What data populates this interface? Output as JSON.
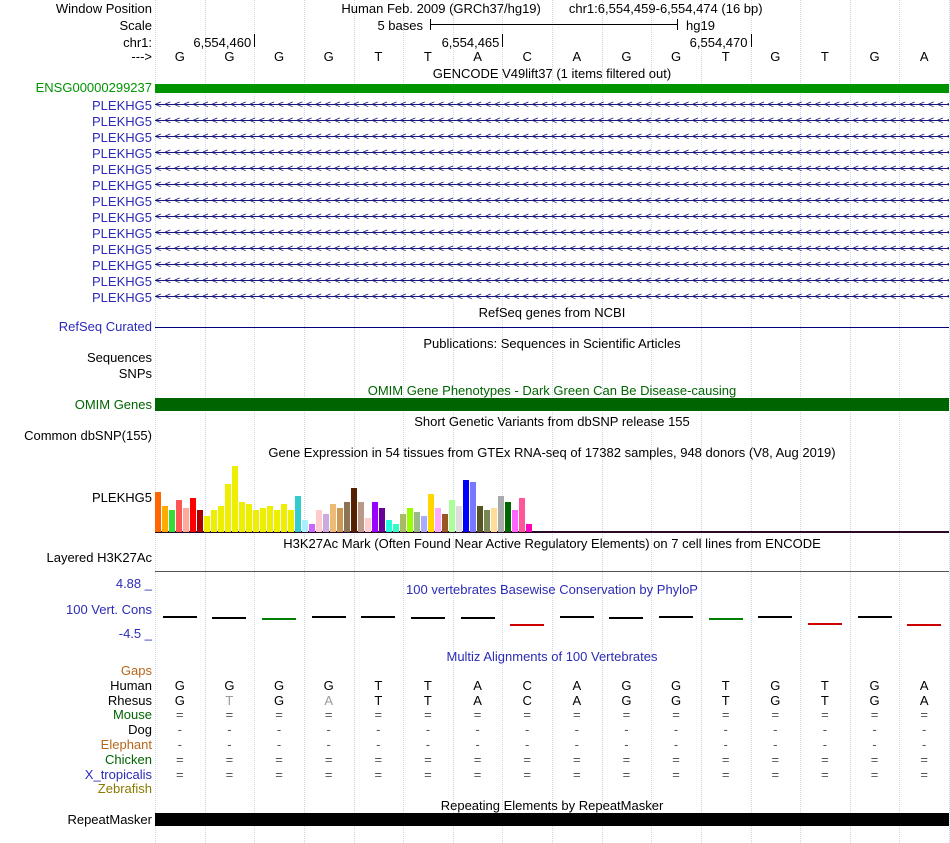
{
  "header": {
    "window_position_label": "Window Position",
    "assembly": "Human Feb. 2009 (GRCh37/hg19)",
    "position": "chr1:6,554,459-6,554,474 (16 bp)",
    "scale_label": "Scale",
    "scale_bar_label": "5 bases",
    "assembly_tag": "hg19",
    "chrom_label": "chr1:",
    "strand_arrow": "--->"
  },
  "ruler": {
    "ticks": [
      {
        "label": "6,554,460",
        "offset": 2
      },
      {
        "label": "6,554,465",
        "offset": 7
      },
      {
        "label": "6,554,470",
        "offset": 12
      }
    ]
  },
  "sequence": {
    "bases": [
      "G",
      "G",
      "G",
      "G",
      "T",
      "T",
      "A",
      "C",
      "A",
      "G",
      "G",
      "T",
      "G",
      "T",
      "G",
      "A"
    ]
  },
  "gencode": {
    "title": "GENCODE V49lift37 (1 items filtered out)",
    "gene": {
      "label": "ENSG00000299237",
      "color": "#009400"
    },
    "transcript_labels": [
      "PLEKHG5",
      "PLEKHG5",
      "PLEKHG5",
      "PLEKHG5",
      "PLEKHG5",
      "PLEKHG5",
      "PLEKHG5",
      "PLEKHG5",
      "PLEKHG5",
      "PLEKHG5",
      "PLEKHG5",
      "PLEKHG5",
      "PLEKHG5"
    ],
    "arrow_char": "<",
    "line_color": "#16167d"
  },
  "refseq": {
    "title": "RefSeq genes from NCBI",
    "label": "RefSeq Curated"
  },
  "publications": {
    "title": "Publications: Sequences in Scientific Articles",
    "sequences_label": "Sequences",
    "snps_label": "SNPs"
  },
  "omim": {
    "title": "OMIM Gene Phenotypes - Dark Green Can Be Disease-causing",
    "label": "OMIM Genes",
    "color": "#006400"
  },
  "dbsnp": {
    "title": "Short Genetic Variants from dbSNP release 155",
    "label": "Common dbSNP(155)"
  },
  "gtex": {
    "title": "Gene Expression in 54 tissues from GTEx RNA-seq of 17382 samples, 948 donors (V8, Aug 2019)",
    "label": "PLEKHG5",
    "chart_data": {
      "type": "bar",
      "n_bars": 54,
      "note": "relative expression bar heights in px (max 70)",
      "values": [
        40,
        26,
        22,
        32,
        24,
        34,
        22,
        16,
        22,
        26,
        48,
        66,
        30,
        28,
        22,
        24,
        26,
        22,
        28,
        22,
        36,
        12,
        8,
        22,
        18,
        28,
        24,
        30,
        44,
        30,
        14,
        30,
        24,
        12,
        8,
        18,
        24,
        20,
        16,
        38,
        24,
        18,
        32,
        26,
        52,
        50,
        26,
        22,
        24,
        36,
        30,
        22,
        34,
        8
      ],
      "colors": [
        "#FF6600",
        "#FFAA00",
        "#33DD33",
        "#FF5555",
        "#FFAA99",
        "#FF0000",
        "#AA0000",
        "#EEEE00",
        "#EEEE00",
        "#EEEE00",
        "#EEEE00",
        "#EEEE00",
        "#EEEE00",
        "#EEEE00",
        "#EEEE00",
        "#EEEE00",
        "#EEEE00",
        "#EEEE00",
        "#EEEE00",
        "#EEEE00",
        "#33CCCC",
        "#AAEEFF",
        "#CC66FF",
        "#FFCCCC",
        "#CCAADD",
        "#EEBB77",
        "#CC9955",
        "#8B7355",
        "#552200",
        "#BB9988",
        "#FFCCCC",
        "#9900FF",
        "#660099",
        "#22FFDD",
        "#33FFC2",
        "#AABB66",
        "#99FF00",
        "#99BB88",
        "#AAAAFF",
        "#FFD700",
        "#FFAAFF",
        "#995522",
        "#AAFF99",
        "#DDDDDD",
        "#0000FF",
        "#7777FF",
        "#555522",
        "#778855",
        "#FFDD99",
        "#AAAAAA",
        "#006600",
        "#FF66FF",
        "#FF5599",
        "#FF00BB"
      ]
    }
  },
  "h3k27ac": {
    "title": "H3K27Ac Mark (Often Found Near Active Regulatory Elements) on 7 cell lines from ENCODE",
    "label": "Layered H3K27Ac"
  },
  "phylop": {
    "title": "100 vertebrates Basewise Conservation by PhyloP",
    "label": "100 Vert. Cons",
    "max_label": "4.88 _",
    "min_label": "-4.5 _",
    "chart_data": {
      "type": "wiggle",
      "ylim": [
        -4.5,
        4.88
      ],
      "values": [
        0.5,
        0.4,
        0.2,
        0.45,
        0.55,
        0.35,
        0.4,
        -0.45,
        0.5,
        0.4,
        0.45,
        0.2,
        0.5,
        -0.35,
        0.45,
        -0.5
      ],
      "colors": [
        "#000000",
        "#000000",
        "#008000",
        "#000000",
        "#000000",
        "#000000",
        "#000000",
        "#cc0000",
        "#000000",
        "#000000",
        "#000000",
        "#008000",
        "#000000",
        "#cc0000",
        "#000000",
        "#cc0000"
      ]
    }
  },
  "multiz": {
    "title": "Multiz Alignments of 100 Vertebrates",
    "rows": [
      {
        "species": "Gaps",
        "color": "#b8651b",
        "cells": [
          "",
          "",
          "",
          "",
          "",
          "",
          "",
          "",
          "",
          "",
          "",
          "",
          "",
          "",
          "",
          ""
        ]
      },
      {
        "species": "Human",
        "color": "#000000",
        "cells": [
          "G",
          "G",
          "G",
          "G",
          "T",
          "T",
          "A",
          "C",
          "A",
          "G",
          "G",
          "T",
          "G",
          "T",
          "G",
          "A"
        ]
      },
      {
        "species": "Rhesus",
        "color": "#000000",
        "cells": [
          "G",
          "T",
          "G",
          "A",
          "T",
          "T",
          "A",
          "C",
          "A",
          "G",
          "G",
          "T",
          "G",
          "T",
          "G",
          "A"
        ],
        "dim_indices": [
          1,
          3
        ]
      },
      {
        "species": "Mouse",
        "color": "#006400",
        "cells": [
          "=",
          "=",
          "=",
          "=",
          "=",
          "=",
          "=",
          "=",
          "=",
          "=",
          "=",
          "=",
          "=",
          "=",
          "=",
          "="
        ]
      },
      {
        "species": "Dog",
        "color": "#000000",
        "cells": [
          "-",
          "-",
          "-",
          "-",
          "-",
          "-",
          "-",
          "-",
          "-",
          "-",
          "-",
          "-",
          "-",
          "-",
          "-",
          "-"
        ]
      },
      {
        "species": "Elephant",
        "color": "#b8651b",
        "cells": [
          "-",
          "-",
          "-",
          "-",
          "-",
          "-",
          "-",
          "-",
          "-",
          "-",
          "-",
          "-",
          "-",
          "-",
          "-",
          "-"
        ]
      },
      {
        "species": "Chicken",
        "color": "#006400",
        "cells": [
          "=",
          "=",
          "=",
          "=",
          "=",
          "=",
          "=",
          "=",
          "=",
          "=",
          "=",
          "=",
          "=",
          "=",
          "=",
          "="
        ]
      },
      {
        "species": "X_tropicalis",
        "color": "#2b2bb8",
        "cells": [
          "=",
          "=",
          "=",
          "=",
          "=",
          "=",
          "=",
          "=",
          "=",
          "=",
          "=",
          "=",
          "=",
          "=",
          "=",
          "="
        ]
      },
      {
        "species": "Zebrafish",
        "color": "#8a7a00",
        "cells": [
          "",
          "",
          "",
          "",
          "",
          "",
          "",
          "",
          "",
          "",
          "",
          "",
          "",
          "",
          "",
          ""
        ]
      }
    ]
  },
  "repeatmasker": {
    "title": "Repeating Elements by RepeatMasker",
    "label": "RepeatMasker"
  },
  "colors": {
    "track_label_blue": "#2b2bb8",
    "omim_dark_green": "#006400",
    "gene_green": "#009400",
    "gridline_blue": "#c7d9eb"
  }
}
